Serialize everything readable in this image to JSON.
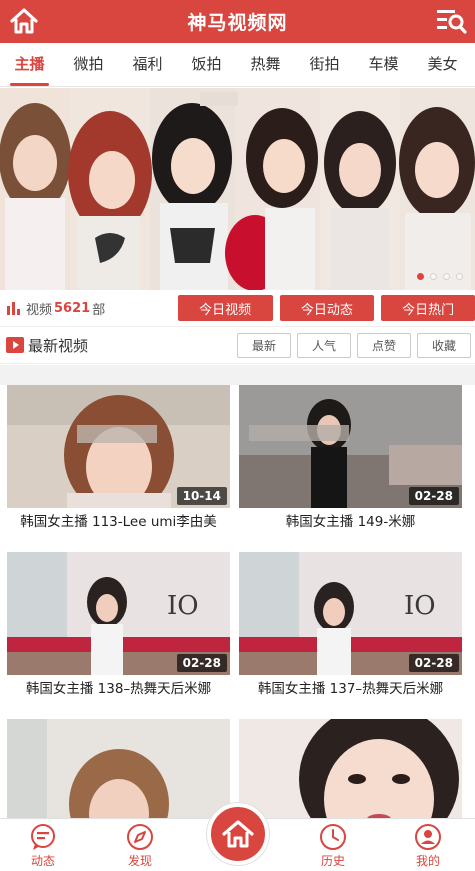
{
  "header": {
    "title": "神马视频网"
  },
  "tabs": [
    {
      "label": "主播",
      "active": true
    },
    {
      "label": "微拍"
    },
    {
      "label": "福利"
    },
    {
      "label": "饭拍"
    },
    {
      "label": "热舞"
    },
    {
      "label": "街拍"
    },
    {
      "label": "车模"
    },
    {
      "label": "美女"
    }
  ],
  "banner": {
    "slides": 4,
    "active_slide": 1
  },
  "stats": {
    "prefix": "视频",
    "count": "5621",
    "suffix": "部"
  },
  "today_buttons": [
    "今日视频",
    "今日动态",
    "今日热门"
  ],
  "section": {
    "title": "最新视频",
    "sort": [
      "最新",
      "人气",
      "点赞",
      "收藏"
    ]
  },
  "videos": [
    {
      "title": "韩国女主播 113-Lee umi李由美",
      "date": "10-14"
    },
    {
      "title": "韩国女主播 149-米娜",
      "date": "02-28"
    },
    {
      "title": "韩国女主播 138–热舞天后米娜",
      "date": "02-28"
    },
    {
      "title": "韩国女主播 137–热舞天后米娜",
      "date": "02-28"
    },
    {
      "title": "",
      "date": ""
    },
    {
      "title": "",
      "date": ""
    }
  ],
  "bottom_nav": {
    "items": [
      "动态",
      "发现",
      "历史",
      "我的"
    ]
  },
  "colors": {
    "accent": "#d9453f"
  }
}
